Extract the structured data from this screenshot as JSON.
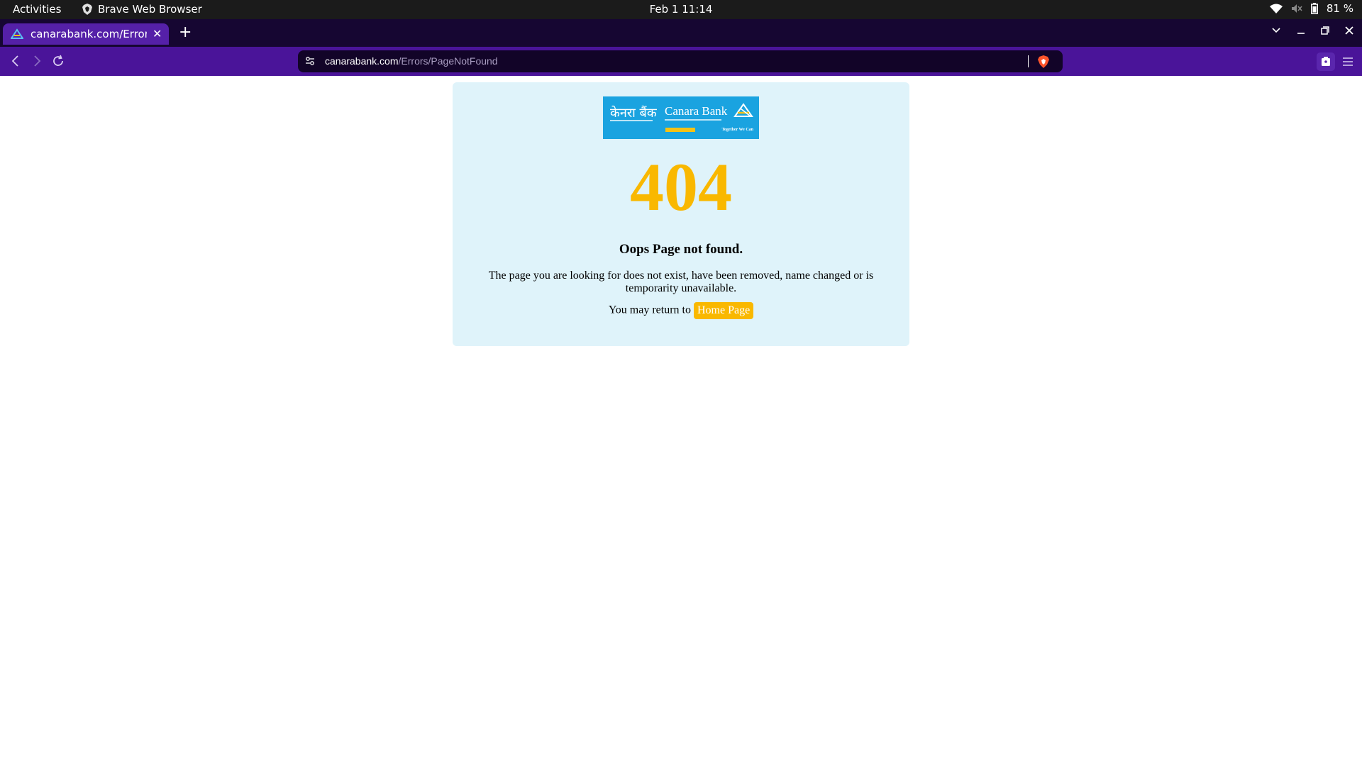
{
  "system_bar": {
    "activities": "Activities",
    "app_name": "Brave Web Browser",
    "clock": "Feb 1  11:14",
    "battery": "81 %"
  },
  "browser": {
    "tab_title": "canarabank.com/Errors/",
    "new_tab_label": "+",
    "url_host": "canarabank.com",
    "url_path": "/Errors/PageNotFound"
  },
  "page": {
    "logo": {
      "hindi": "केनरा बैंक",
      "english": "Canara Bank",
      "tagline": "Together We Can"
    },
    "error_code": "404",
    "heading": "Oops Page not found.",
    "message": "The page you are looking for does not exist, have been removed, name changed or is temporarity unavailable.",
    "return_text": "You may return to",
    "home_link": "Home Page"
  },
  "colors": {
    "tab_active": "#5520a8",
    "toolbar": "#4a1499",
    "card_bg": "#dff3fa",
    "accent_yellow": "#f9b800",
    "logo_blue": "#1aa3e0"
  }
}
